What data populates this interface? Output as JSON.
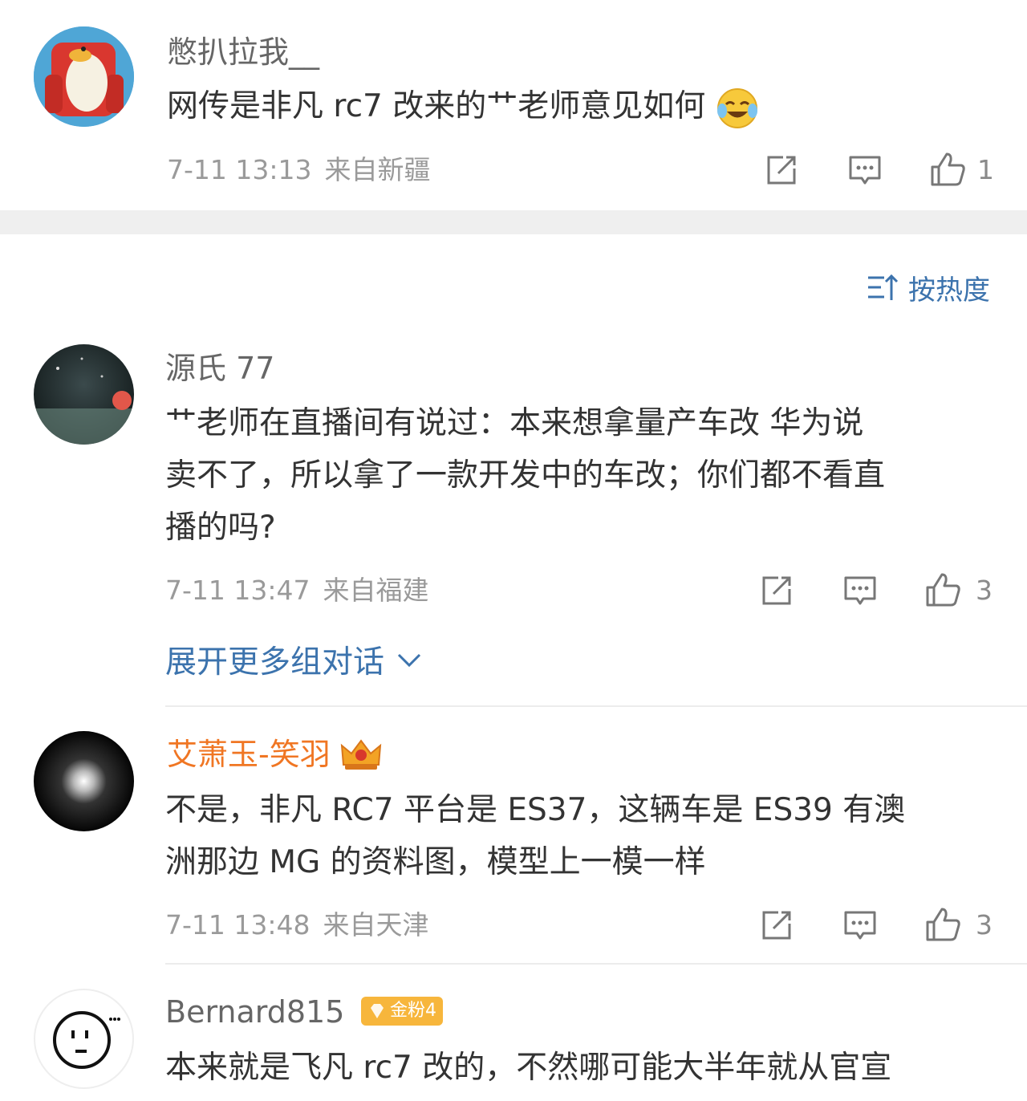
{
  "comments": [
    {
      "username": "憋扒拉我__",
      "text": "网传是非凡 rc7 改来的艹老师意见如何",
      "emoji": "laugh-cry-emoji",
      "time": "7-11 13:13",
      "location": "来自新疆",
      "likes": "1"
    },
    {
      "username": "源氏 77",
      "text_lines": [
        "艹老师在直播间有说过：本来想拿量产车改  华为说",
        "卖不了，所以拿了一款开发中的车改；你们都不看直",
        "播的吗?"
      ],
      "time": "7-11 13:47",
      "location": "来自福建",
      "likes": "3"
    },
    {
      "username": "艾萧玉-笑羽",
      "text_lines": [
        "不是，非凡 RC7 平台是 ES37，这辆车是 ES39 有澳",
        "洲那边 MG 的资料图，模型上一模一样"
      ],
      "time": "7-11 13:48",
      "location": "来自天津",
      "likes": "3"
    },
    {
      "username": "Bernard815",
      "badge": "金粉4",
      "text_lines": [
        "本来就是飞凡 rc7 改的，不然哪可能大半年就从官宣"
      ]
    }
  ],
  "sort": {
    "label": "按热度"
  },
  "expand_more": {
    "label": "展开更多组对话"
  },
  "colors": {
    "link_blue": "#3c73ad",
    "vip_orange": "#f07623",
    "badge_gold": "#f7b63c"
  }
}
